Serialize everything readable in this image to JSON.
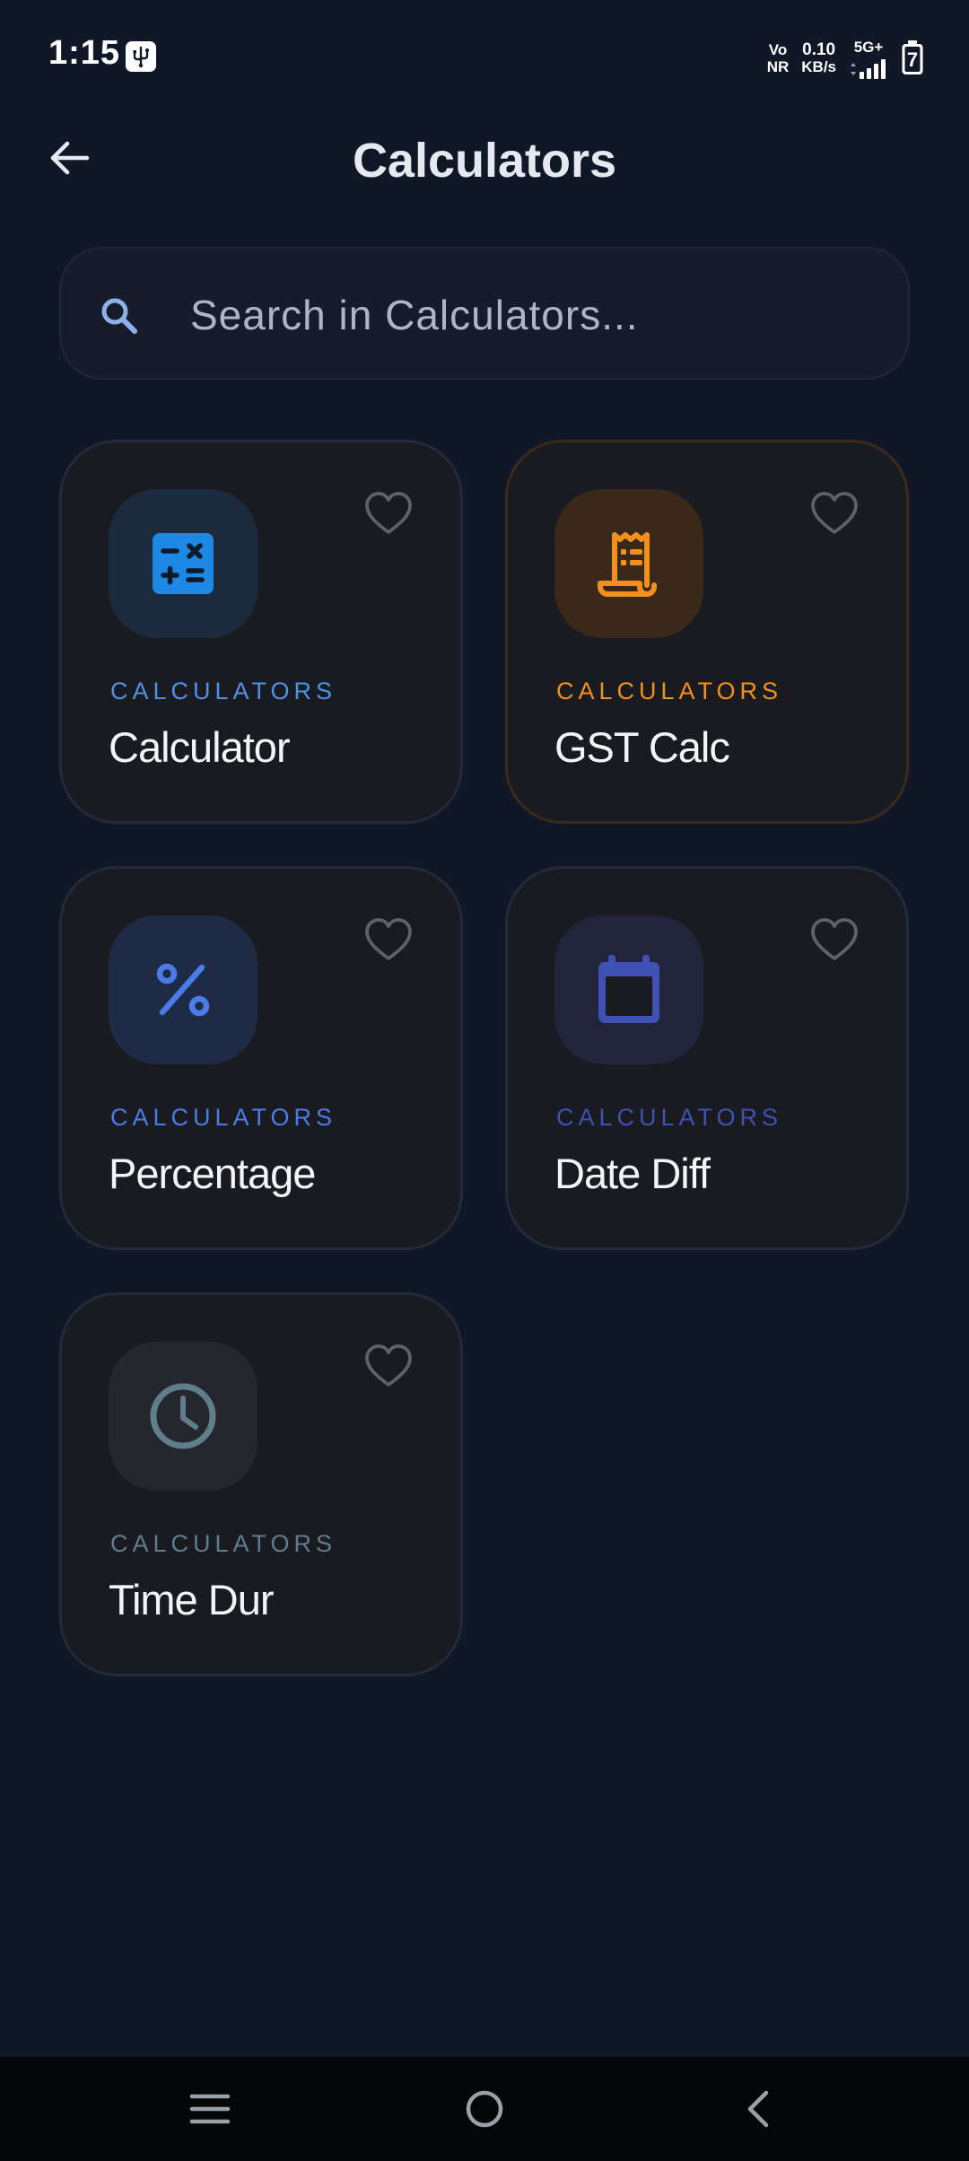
{
  "status_bar": {
    "time": "1:15",
    "volte_top": "Vo",
    "volte_bottom": "NR",
    "speed_value": "0.10",
    "speed_unit": "KB/s",
    "network": "5G+",
    "battery_level": "7",
    "icons": [
      "usb-icon",
      "signal-icon",
      "battery-icon"
    ]
  },
  "header": {
    "title": "Calculators",
    "back_icon": "arrow-left-icon"
  },
  "search": {
    "placeholder": "Search in Calculators...",
    "value": "",
    "icon": "search-icon"
  },
  "cards": [
    {
      "category": "CALCULATORS",
      "title": "Calculator",
      "icon": "calculator-icon",
      "accent": "#1e88e5"
    },
    {
      "category": "CALCULATORS",
      "title": "GST Calc",
      "icon": "receipt-icon",
      "accent": "#f2901d"
    },
    {
      "category": "CALCULATORS",
      "title": "Percentage",
      "icon": "percent-icon",
      "accent": "#4a7ce8"
    },
    {
      "category": "CALCULATORS",
      "title": "Date Diff",
      "icon": "calendar-icon",
      "accent": "#3f51b5"
    },
    {
      "category": "CALCULATORS",
      "title": "Time Dur",
      "icon": "clock-icon",
      "accent": "#607d8b"
    }
  ],
  "nav_bar": {
    "icons": [
      "menu-icon",
      "home-icon",
      "back-icon"
    ]
  },
  "colors": {
    "background": "#101828",
    "card": "#1a1b20",
    "nav": "#050608"
  }
}
